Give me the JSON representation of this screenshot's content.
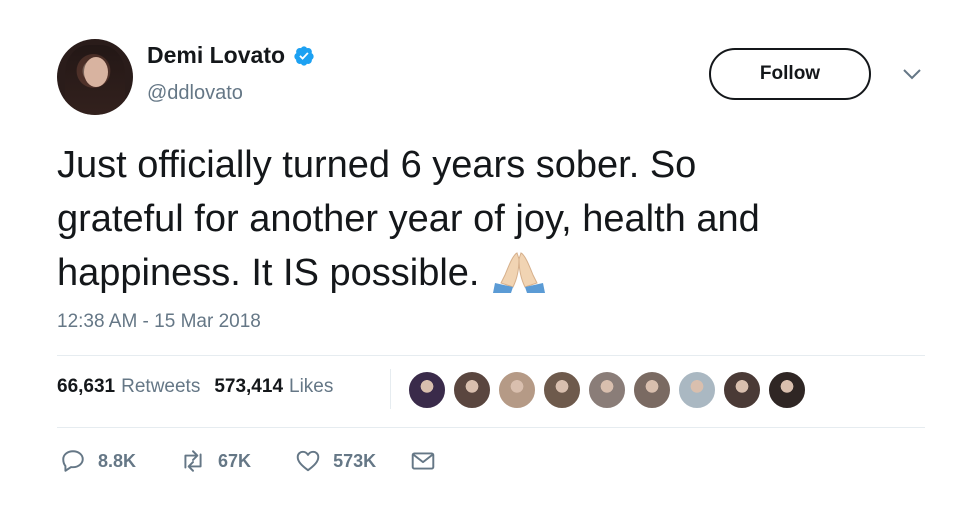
{
  "user": {
    "name": "Demi Lovato",
    "handle": "@ddlovato",
    "verified": true
  },
  "follow_label": "Follow",
  "tweet": {
    "lines": [
      "Just officially turned 6 years sober. So",
      "grateful for another year of joy, health and",
      "happiness. It IS possible."
    ],
    "emoji": "folded-hands-emoji",
    "timestamp": "12:38 AM - 15 Mar 2018"
  },
  "stats": {
    "retweets_count": "66,631",
    "retweets_label": "Retweets",
    "likes_count": "573,414",
    "likes_label": "Likes"
  },
  "liker_avatars": [
    {
      "color": "#3a2b4a"
    },
    {
      "color": "#5a463f"
    },
    {
      "color": "#b59a86"
    },
    {
      "color": "#6e5a4c"
    },
    {
      "color": "#8a7d78"
    },
    {
      "color": "#7a6a62"
    },
    {
      "color": "#aab8c2"
    },
    {
      "color": "#4a3a36"
    },
    {
      "color": "#2f2624"
    }
  ],
  "actions": {
    "reply_count": "8.8K",
    "retweet_count": "67K",
    "like_count": "573K"
  },
  "colors": {
    "text": "#14171a",
    "secondary": "#657786",
    "verified": "#1da1f2",
    "divider": "#e6ecf0"
  }
}
